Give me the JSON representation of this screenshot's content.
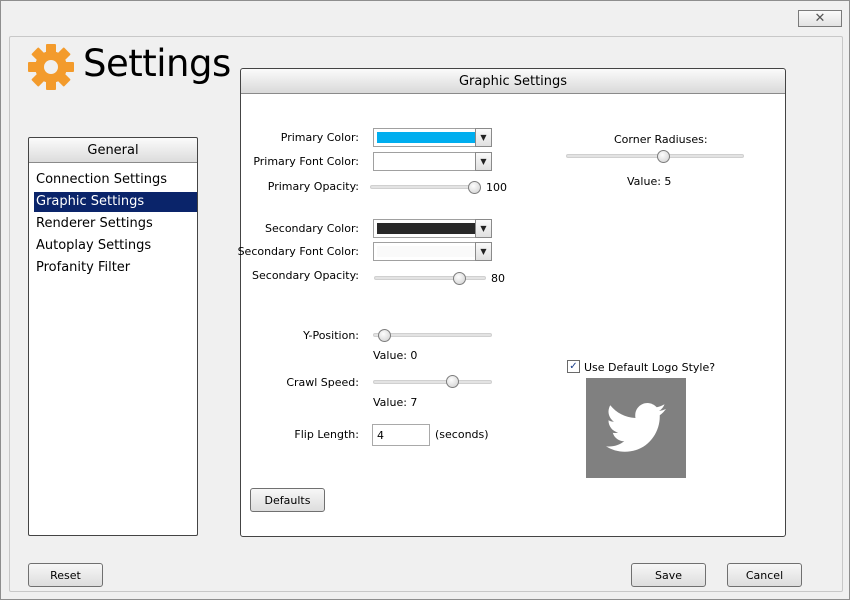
{
  "window": {
    "close_glyph": "✕"
  },
  "app": {
    "title": "Settings",
    "icon": "gear-icon",
    "icon_color": "#f39b2c"
  },
  "nav": {
    "header": "General",
    "items": [
      {
        "label": "Connection Settings",
        "selected": false
      },
      {
        "label": "Graphic Settings",
        "selected": true
      },
      {
        "label": "Renderer Settings",
        "selected": false
      },
      {
        "label": "Autoplay Settings",
        "selected": false
      },
      {
        "label": "Profanity Filter",
        "selected": false
      }
    ],
    "selected_color": "#0a246a"
  },
  "graphic": {
    "title": "Graphic Settings",
    "primary_color": {
      "label": "Primary Color:",
      "value": "#00aeef"
    },
    "primary_font_color": {
      "label": "Primary Font Color:",
      "value": "#ffffff"
    },
    "primary_opacity": {
      "label": "Primary Opacity:",
      "value": "100",
      "fraction": 1.0
    },
    "secondary_color": {
      "label": "Secondary Color:",
      "value": "#282828"
    },
    "secondary_font_color": {
      "label": "Secondary Font Color:",
      "value": "#fafafa"
    },
    "secondary_opacity": {
      "label": "Secondary Opacity:",
      "value": "80",
      "fraction": 0.8
    },
    "corner_radiuses": {
      "label": "Corner Radiuses:",
      "value_text": "Value: 5",
      "fraction": 0.55
    },
    "y_position": {
      "label": "Y-Position:",
      "value_text": "Value:  0",
      "fraction": 0.0
    },
    "crawl_speed": {
      "label": "Crawl Speed:",
      "value_text": "Value:  7",
      "fraction": 0.7
    },
    "flip_length": {
      "label": "Flip Length:",
      "value": "4",
      "unit": "(seconds)"
    },
    "logo_style": {
      "label": "Use Default Logo Style?",
      "checked": true,
      "check_glyph": "✓",
      "logo_icon": "twitter-bird-icon"
    },
    "defaults_button": "Defaults"
  },
  "footer": {
    "reset": "Reset",
    "save": "Save",
    "cancel": "Cancel"
  }
}
